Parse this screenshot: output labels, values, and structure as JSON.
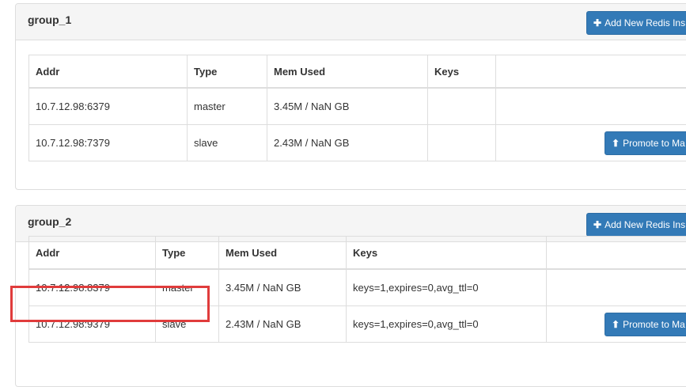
{
  "groups": [
    {
      "title": "group_1",
      "add_button_label": "Add New Redis Ins",
      "add_button_icon": "plus-icon",
      "columns": [
        "Addr",
        "Type",
        "Mem Used",
        "Keys",
        ""
      ],
      "rows": [
        {
          "addr": "10.7.12.98:6379",
          "type": "master",
          "mem": "3.45M / NaN GB",
          "keys": "",
          "action": ""
        },
        {
          "addr": "10.7.12.98:7379",
          "type": "slave",
          "mem": "2.43M / NaN GB",
          "keys": "",
          "action": "Promote to Ma"
        }
      ]
    },
    {
      "title": "group_2",
      "add_button_label": "Add New Redis Ins",
      "add_button_icon": "plus-icon",
      "columns": [
        "Addr",
        "Type",
        "Mem Used",
        "Keys",
        ""
      ],
      "rows": [
        {
          "addr": "10.7.12.98:8379",
          "type": "master",
          "mem": "3.45M / NaN GB",
          "keys": "keys=1,expires=0,avg_ttl=0",
          "action": ""
        },
        {
          "addr": "10.7.12.98:9379",
          "type": "slave",
          "mem": "2.43M / NaN GB",
          "keys": "keys=1,expires=0,avg_ttl=0",
          "action": "Promote to Ma"
        }
      ]
    }
  ],
  "colors": {
    "primary_button": "#337ab7",
    "highlight_box": "#e03c3c",
    "panel_heading_bg": "#f5f5f5",
    "border": "#dddddd"
  }
}
